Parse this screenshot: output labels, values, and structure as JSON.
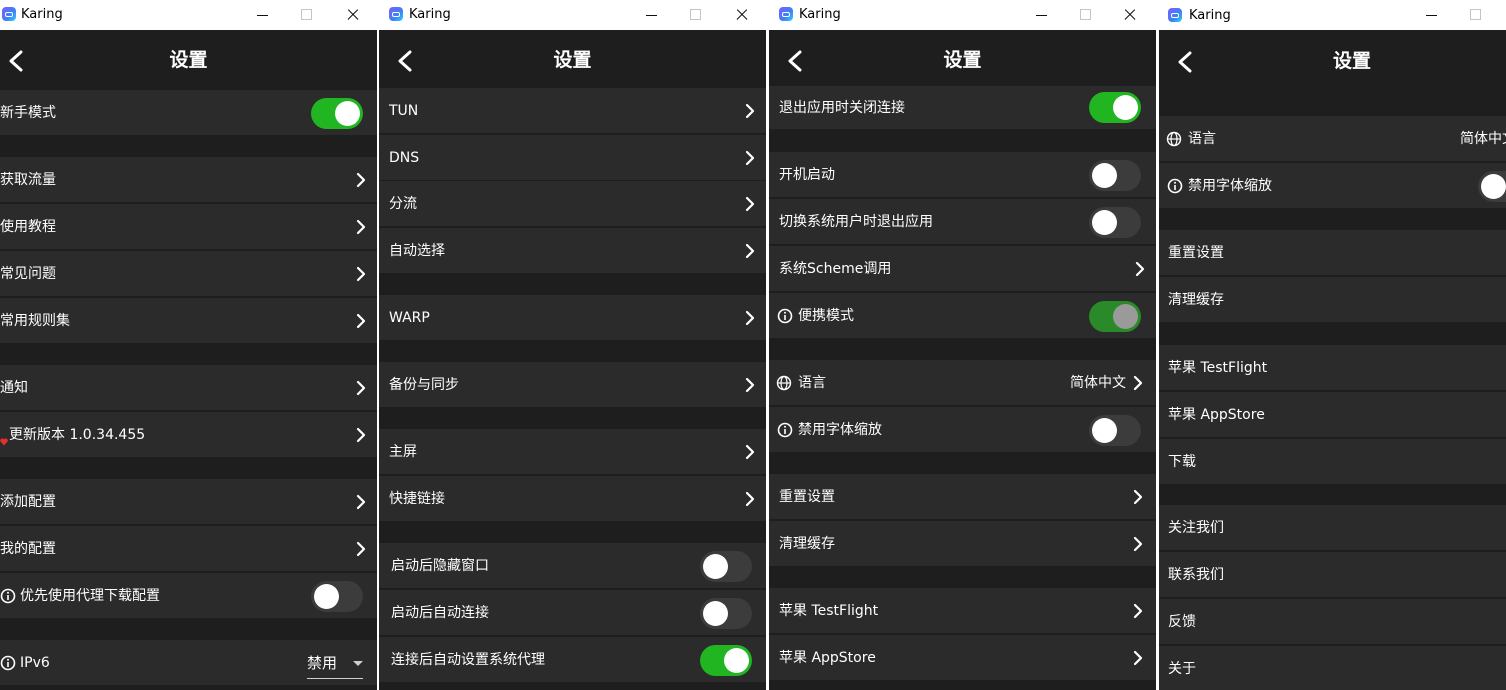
{
  "app": {
    "name": "Karing"
  },
  "header": {
    "title": "设置"
  },
  "panel1": {
    "newbie": "新手模式",
    "get_traffic": "获取流量",
    "tutorial": "使用教程",
    "faq": "常见问题",
    "rulesets": "常用规则集",
    "notifications": "通知",
    "update": "更新版本 1.0.34.455",
    "add_config": "添加配置",
    "my_config": "我的配置",
    "prefer_proxy_download": "优先使用代理下载配置",
    "ipv6": "IPv6",
    "ipv6_value": "禁用"
  },
  "panel2": {
    "tun": "TUN",
    "dns": "DNS",
    "routing": "分流",
    "auto_select": "自动选择",
    "warp": "WARP",
    "backup_sync": "备份与同步",
    "home_screen": "主屏",
    "shortcuts": "快捷链接",
    "hide_window_on_start": "启动后隐藏窗口",
    "auto_connect_on_start": "启动后自动连接",
    "auto_system_proxy": "连接后自动设置系统代理"
  },
  "panel3": {
    "close_on_exit": "退出应用时关闭连接",
    "launch_at_boot": "开机启动",
    "exit_on_user_switch": "切换系统用户时退出应用",
    "scheme_call": "系统Scheme调用",
    "portable_mode": "便携模式",
    "language": "语言",
    "language_value": "简体中文",
    "disable_font_scaling": "禁用字体缩放",
    "reset_settings": "重置设置",
    "clear_cache": "清理缓存",
    "testflight": "苹果 TestFlight",
    "appstore": "苹果 AppStore"
  },
  "panel4": {
    "language": "语言",
    "language_value": "简体中文",
    "disable_font_scaling": "禁用字体缩放",
    "reset_settings": "重置设置",
    "clear_cache": "清理缓存",
    "testflight": "苹果 TestFlight",
    "appstore": "苹果 AppStore",
    "download": "下载",
    "follow_us": "关注我们",
    "contact_us": "联系我们",
    "feedback": "反馈",
    "about": "关于"
  },
  "colors": {
    "toggle_on": "#22b522",
    "toggle_off": "#3c3c3c",
    "row_bg": "#2b2b2b",
    "page_bg": "#1e1e1e",
    "heart": "#e0312f"
  }
}
